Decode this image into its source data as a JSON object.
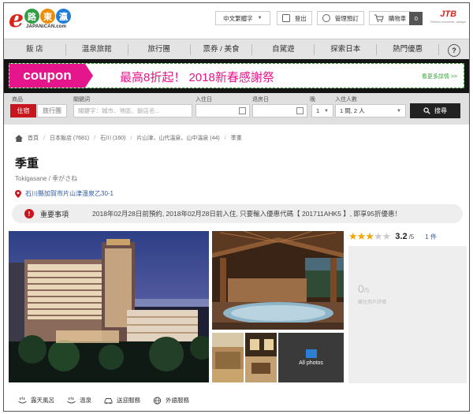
{
  "logo": {
    "letter": "e",
    "badges": [
      "路",
      "東",
      "瀛"
    ],
    "badge_colors": [
      "#2f9e44",
      "#f08c00",
      "#1c7ed6"
    ],
    "subtitle": "JAPANiCAN.com"
  },
  "header": {
    "language": "中文繁體字",
    "login": "登出",
    "manage": "管理預訂",
    "cart": "購物車",
    "cart_count": "0",
    "partner_logo": "JTB",
    "partner_sub": "Perfect moments, always"
  },
  "nav": {
    "items": [
      "飯 店",
      "溫泉旅館",
      "旅行團",
      "票券 / 美食",
      "自駕遊",
      "探索日本",
      "熱門優惠"
    ],
    "help": "?"
  },
  "banner": {
    "coupon": "coupon",
    "headline": "最高8折起！ 2018新春感謝祭",
    "more": "看更多詳情 >>"
  },
  "search": {
    "labels": {
      "product": "商品",
      "keyword": "關鍵詞",
      "checkin": "入住日",
      "checkout": "退房日",
      "nights": "晚",
      "guests": "入住人數"
    },
    "tab_active": "住宿",
    "tab_other": "旅行團",
    "keyword_placeholder": "關鍵字：城市、地區、飯店名...",
    "nights_value": "1",
    "guests_value": "1 間, 2 人",
    "button": "搜尋"
  },
  "breadcrumb": [
    "首頁",
    "日本飯店 (7681)",
    "石川 (160)",
    "片山津、山代溫泉、山中溫泉 (44)",
    "季重"
  ],
  "hotel": {
    "name": "季重",
    "romaji": "Tokigasane / 季がさね",
    "address": "石川縣加賀市片山津溫泉乙30-1"
  },
  "notice": {
    "label": "重要事項",
    "text": "2018年02月28日前預約, 2018年02月28日前入住, 只要輸入優惠代碼【 201711AHK5 】, 即享95折優惠！"
  },
  "gallery": {
    "all_photos": "All photos"
  },
  "rating": {
    "stars_filled": 3,
    "stars_total": 5,
    "score": "3.2",
    "score_max": "/5",
    "reviews": "1 件",
    "user_score": "0",
    "user_score_max": "/5",
    "user_caption": "職住用戶評價"
  },
  "amenities": [
    "露天風呂",
    "溫泉",
    "送迎服務",
    "外語服務"
  ]
}
